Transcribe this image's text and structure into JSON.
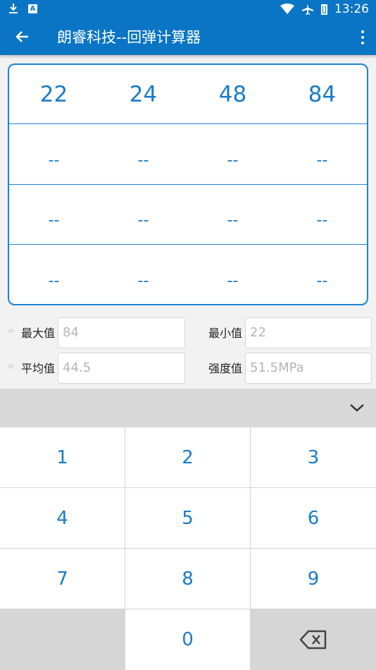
{
  "status_bar": {
    "time": "13:26",
    "icons": [
      "download-icon",
      "app-a-icon",
      "wifi-icon",
      "airplane-icon",
      "battery-icon"
    ]
  },
  "app_bar": {
    "title": "朗睿科技--回弹计算器"
  },
  "grid": {
    "row1": [
      "22",
      "24",
      "48",
      "84"
    ],
    "row2": [
      "--",
      "--",
      "--",
      "--"
    ],
    "row3": [
      "--",
      "--",
      "--",
      "--"
    ],
    "row4": [
      "--",
      "--",
      "--",
      "--"
    ]
  },
  "stats": {
    "max_label": "最大值",
    "max_value": "84",
    "min_label": "最小值",
    "min_value": "22",
    "avg_label": "平均值",
    "avg_value": "44.5",
    "strength_label": "强度值",
    "strength_value": "51.5MPa"
  },
  "keypad": {
    "k1": "1",
    "k2": "2",
    "k3": "3",
    "k4": "4",
    "k5": "5",
    "k6": "6",
    "k7": "7",
    "k8": "8",
    "k9": "9",
    "k0": "0"
  },
  "colors": {
    "primary": "#0a75c4",
    "accent": "#1a84d6",
    "digit": "#1a7bc8"
  }
}
